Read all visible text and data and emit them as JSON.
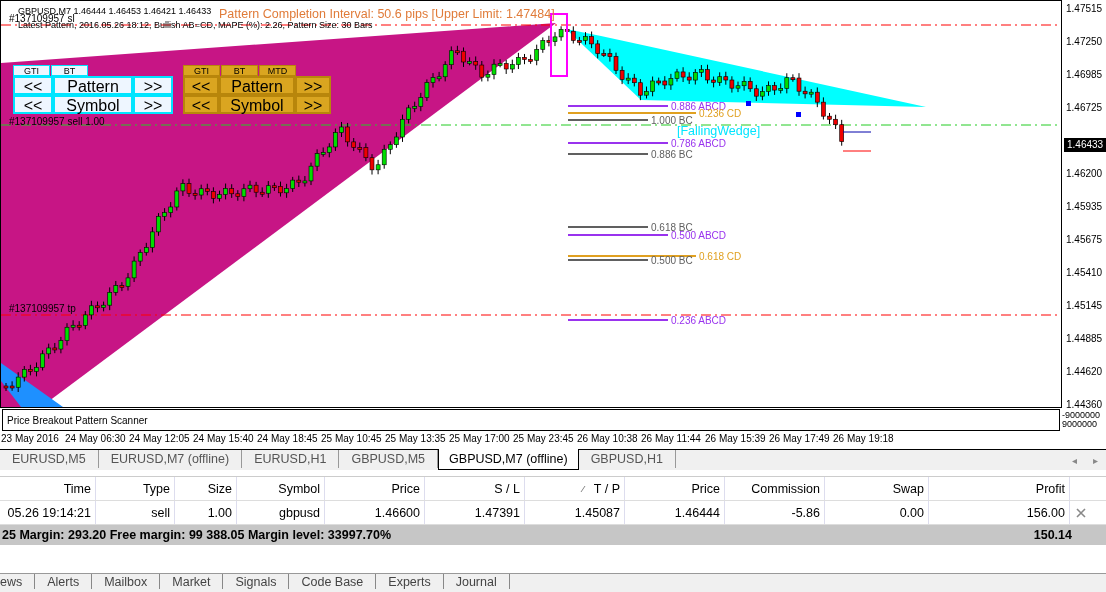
{
  "chart": {
    "symbol_info": "GBPUSD,M7  1.46444 1.46453 1.46421 1.46433",
    "pattern_info": "Latest Pattern, 2016.05.26 18:12, Bullish AB=CD, MAPE (%): 2.26, Pattern Size: 30 Bars",
    "completion_interval": "Pattern Completion Interval: 50.6 pips [Upper Limit: 1.47484]",
    "pattern_name": "[FallingWedge]",
    "order_labels": [
      {
        "kind": "sl",
        "text": "#137109957 sl"
      },
      {
        "kind": "entry",
        "text": "#137109957 sell 1.00"
      },
      {
        "kind": "tp",
        "text": "#137109957 tp"
      }
    ],
    "fib_levels": [
      {
        "text": "0.886 ABCD",
        "color": "#9933ee"
      },
      {
        "text": "0.236 CD",
        "color": "#e0a020"
      },
      {
        "text": "1.000 BC",
        "color": "#606060"
      },
      {
        "text": "0.786 ABCD",
        "color": "#9933ee"
      },
      {
        "text": "0.886 BC",
        "color": "#606060"
      },
      {
        "text": "0.618 BC",
        "color": "#606060"
      },
      {
        "text": "0.500 ABCD",
        "color": "#9933ee"
      },
      {
        "text": "0.618 CD",
        "color": "#e0a020"
      },
      {
        "text": "0.500 BC",
        "color": "#606060"
      },
      {
        "text": "0.236 ABCD",
        "color": "#9933ee"
      }
    ],
    "panels": [
      {
        "kind": "light",
        "tabs": [
          "GTI",
          "BT"
        ],
        "rows": [
          {
            "prev": "<<",
            "label": "Pattern",
            "next": ">>"
          },
          {
            "prev": "<<",
            "label": "Symbol",
            "next": ">>"
          }
        ]
      },
      {
        "kind": "gold",
        "tabs": [
          "GTI",
          "BT",
          "MTD"
        ],
        "rows": [
          {
            "prev": "<<",
            "label": "Pattern",
            "next": ">>"
          },
          {
            "prev": "<<",
            "label": "Symbol",
            "next": ">>"
          }
        ]
      }
    ],
    "price_axis": [
      "1.47515",
      "1.47250",
      "1.46985",
      "1.46725",
      "1.46200",
      "1.45935",
      "1.45675",
      "1.45410",
      "1.45145",
      "1.44885",
      "1.44620",
      "1.44360"
    ],
    "current_price": "1.46433",
    "indicator": {
      "title": "Price Breakout Pattern Scanner",
      "axis": [
        "-9000000",
        "9000000"
      ]
    },
    "time_axis": [
      "23 May 2016",
      "24 May 06:30",
      "24 May 12:05",
      "24 May 15:40",
      "24 May 18:45",
      "25 May 10:45",
      "25 May 13:35",
      "25 May 17:00",
      "25 May 23:45",
      "26 May 10:38",
      "26 May 11:44",
      "26 May 15:39",
      "26 May 17:49",
      "26 May 19:18"
    ]
  },
  "chart_tabs": [
    {
      "label": "EURUSD,M5",
      "selected": false
    },
    {
      "label": "EURUSD,M7 (offline)",
      "selected": false
    },
    {
      "label": "EURUSD,H1",
      "selected": false
    },
    {
      "label": "GBPUSD,M5",
      "selected": false
    },
    {
      "label": "GBPUSD,M7 (offline)",
      "selected": true
    },
    {
      "label": "GBPUSD,H1",
      "selected": false
    }
  ],
  "tab_scroll": [
    "◂",
    "▸"
  ],
  "table": {
    "columns": [
      {
        "label": "Time",
        "sorted": false
      },
      {
        "label": "Type",
        "sorted": false
      },
      {
        "label": "Size",
        "sorted": false
      },
      {
        "label": "Symbol",
        "sorted": false
      },
      {
        "label": "Price",
        "sorted": false
      },
      {
        "label": "S / L",
        "sorted": false
      },
      {
        "label": "T / P",
        "sorted": true
      },
      {
        "label": "Price",
        "sorted": false
      },
      {
        "label": "Commission",
        "sorted": false
      },
      {
        "label": "Swap",
        "sorted": false
      },
      {
        "label": "Profit",
        "sorted": false
      }
    ],
    "rows": [
      [
        "05.26 19:14:21",
        "sell",
        "1.00",
        "gbpusd",
        "1.46600",
        "1.47391",
        "1.45087",
        "1.46444",
        "-5.86",
        "0.00",
        "156.00"
      ]
    ],
    "summary": "25  Margin: 293.20  Free margin: 99 388.05  Margin level: 33997.70%",
    "total": "150.14"
  },
  "bottom_tabs": [
    "ews",
    "Alerts",
    "Mailbox",
    "Market",
    "Signals",
    "Code Base",
    "Experts",
    "Journal"
  ]
}
